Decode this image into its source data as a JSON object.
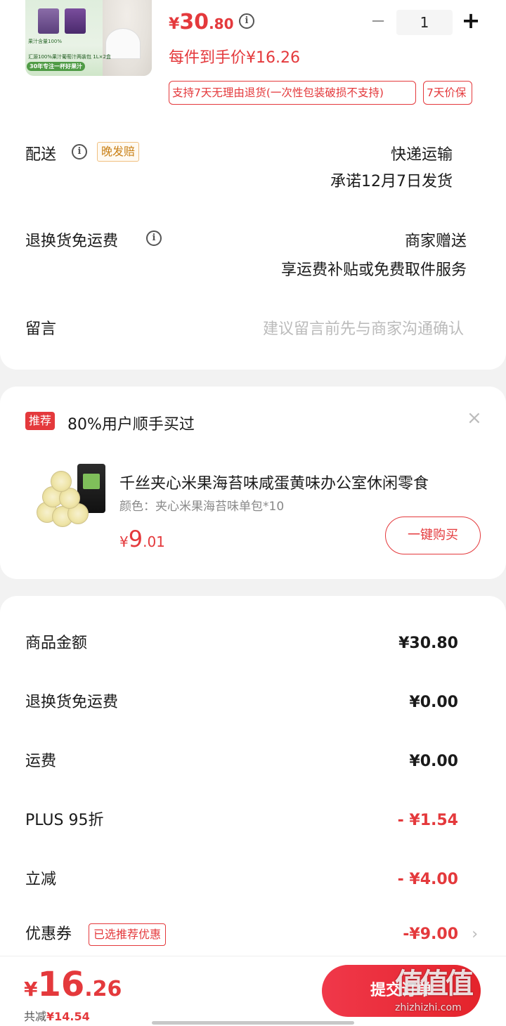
{
  "product": {
    "image_text_1": "汇源100%果汁葡萄汁两装包 1L×2盒",
    "image_text_2": "果汁含量100%",
    "image_text_3": "30年专注一杯好果汁",
    "price_symbol": "¥",
    "price_int": "30",
    "price_dec": ".80",
    "quantity": "1",
    "unit_price_text": "每件到手价¥16.26",
    "return_tag": "支持7天无理由退货(一次性包装破损不支持)",
    "price_protect_tag": "7天价保"
  },
  "delivery": {
    "label": "配送",
    "late_tag": "晚发赔",
    "method": "快递运输",
    "promise": "承诺12月7日发货"
  },
  "return_shipping": {
    "label": "退换货免运费",
    "value": "商家赠送",
    "desc": "享运费补贴或免费取件服务"
  },
  "message": {
    "label": "留言",
    "placeholder": "建议留言前先与商家沟通确认"
  },
  "recommend": {
    "badge": "推荐",
    "title": "80%用户顺手买过",
    "close": "×",
    "item_name": "千丝夹心米果海苔味咸蛋黄味办公室休闲零食",
    "item_attr": "颜色：夹心米果海苔味单包*10",
    "price_symbol": "¥",
    "price_int": "9",
    "price_dec": ".01",
    "buy_label": "一键购买"
  },
  "summary": {
    "rows": [
      {
        "label": "商品金额",
        "value": "¥30.80"
      },
      {
        "label": "退换货免运费",
        "value": "¥0.00"
      },
      {
        "label": "运费",
        "value": "¥0.00"
      },
      {
        "label": "PLUS 95折",
        "value": "- ¥1.54"
      },
      {
        "label": "立减",
        "value": "- ¥4.00"
      },
      {
        "label": "优惠券",
        "value": "-¥9.00"
      }
    ],
    "coupon_tag": "已选推荐优惠",
    "chevron": "›"
  },
  "bottom": {
    "total_symbol": "¥",
    "total_int": "16",
    "total_dec": ".26",
    "saved_label": "共减",
    "saved_value": "¥14.54",
    "submit_label": "提交订单"
  },
  "watermark": {
    "logo": "值值值",
    "url": "zhizhizhi.com"
  },
  "colors": {
    "accent": "#e4393c",
    "late_tag": "#c98016",
    "background": "#f2f2f2"
  }
}
